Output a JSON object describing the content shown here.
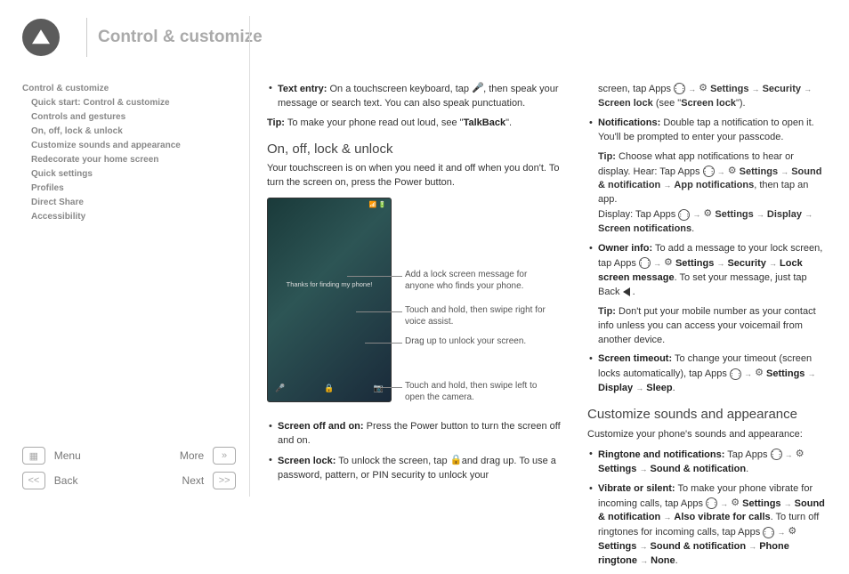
{
  "header": {
    "title": "Control & customize"
  },
  "sidebar": {
    "top": "Control & customize",
    "items": [
      "Quick start: Control & customize",
      "Controls and gestures",
      "On, off, lock & unlock",
      "Customize sounds and appearance",
      "Redecorate your home screen",
      "Quick settings",
      "Profiles",
      "Direct Share",
      "Accessibility"
    ]
  },
  "footer": {
    "menu": "Menu",
    "back": "Back",
    "more": "More",
    "next": "Next"
  },
  "col1": {
    "textentry_label": "Text entry:",
    "textentry_a": " On a touchscreen keyboard, tap ",
    "textentry_b": " , then speak your message or search text. You can also speak punctuation.",
    "tip_label": "Tip:",
    "tip_a": " To make your phone read out loud, see \"",
    "tip_bold": "TalkBack",
    "tip_b": "\".",
    "h2": "On, off, lock & unlock",
    "intro": "Your touchscreen is on when you need it and off when you don't. To turn the screen on, press the Power button.",
    "phone_msg": "Thanks for finding my phone!",
    "callout1": "Add a lock screen message for anyone who finds your phone.",
    "callout2": "Touch and hold, then swipe right for voice assist.",
    "callout3": "Drag up to unlock your screen.",
    "callout4": "Touch and hold, then swipe left to open the camera.",
    "screenoff_label": "Screen off and on:",
    "screenoff_text": " Press the Power button to turn the screen off and on.",
    "screenlock_label": "Screen lock:",
    "screenlock_a": " To unlock the screen, tap ",
    "screenlock_b": " and drag up. To use a password, pattern, or PIN security to unlock your"
  },
  "col2": {
    "cont_a": "screen, tap Apps ",
    "cont_settings": "Settings",
    "cont_security": "Security",
    "cont_screenlock": "Screen lock",
    "cont_b": " (see \"",
    "cont_bold": "Screen lock",
    "cont_c": "\").",
    "notif_label": "Notifications:",
    "notif_text": " Double tap a notification to open it. You'll be prompted to enter your passcode.",
    "notif_tip_label": "Tip:",
    "notif_tip_a": " Choose what app notifications to hear or display. Hear: Tap Apps ",
    "sound_notif": "Sound & notification",
    "app_notif": "App notifications",
    "notif_tip_b": ", then tap an app.",
    "notif_tip_c": "Display: Tap Apps ",
    "display": "Display",
    "screen_notif": "Screen notifications",
    "owner_label": "Owner info:",
    "owner_a": " To add a message to your lock screen, tap Apps ",
    "lockmsg": "Lock screen message",
    "owner_b": ". To set your message, just tap Back ",
    "owner_tip_label": "Tip:",
    "owner_tip": " Don't put your mobile number as your contact info unless you can access your voicemail from another device.",
    "timeout_label": "Screen timeout:",
    "timeout_a": " To change your timeout (screen locks automatically), tap Apps ",
    "sleep": "Sleep",
    "h2": "Customize sounds and appearance",
    "custom_intro": "Customize your phone's sounds and appearance:",
    "ring_label": "Ringtone and notifications:",
    "ring_a": " Tap Apps ",
    "vib_label": "Vibrate or silent:",
    "vib_a": " To make your phone vibrate for incoming calls, tap Apps ",
    "also_vib": "Also vibrate for calls",
    "vib_b": ". To turn off ringtones for incoming calls, tap Apps ",
    "phone_ring": "Phone ringtone",
    "none": "None"
  }
}
